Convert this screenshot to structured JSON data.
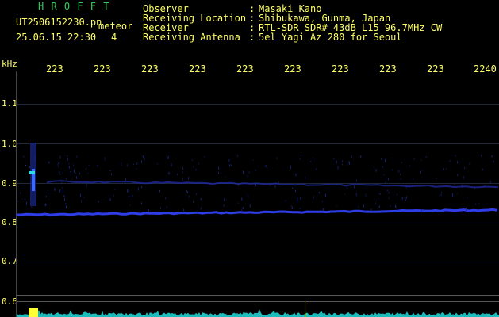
{
  "header": {
    "logo": "H R O F F T",
    "filename": "UT2506152230.pn",
    "type_label": "meteor",
    "datetime": "25.06.15 22:30",
    "count": "4",
    "fields": [
      {
        "label": "Observer",
        "sep": ":",
        "value": "Masaki Kano"
      },
      {
        "label": "Receiving Location",
        "sep": ":",
        "value": "Shibukawa, Gunma, Japan"
      },
      {
        "label": "Receiver",
        "sep": ":",
        "value": "RTL-SDR SDR# 43dB L15 96.7MHz CW"
      },
      {
        "label": "Receiving Antenna",
        "sep": ":",
        "value": "5el Yagi Az 280 for Seoul"
      }
    ]
  },
  "axis": {
    "y_unit": "kHz",
    "y_ticks": [
      "1.1",
      "1.0",
      "0.9",
      "0.8",
      "0.7",
      "0.6"
    ],
    "x_ticks": [
      "223",
      "223",
      "223",
      "223",
      "223",
      "223",
      "223",
      "223",
      "223",
      "2240"
    ]
  },
  "colors": {
    "background": "#000000",
    "text_yellow": "#ffff66",
    "logo_green": "#33cc55",
    "signal_blue": "#3344ff",
    "meter_cyan": "#22dddd"
  }
}
